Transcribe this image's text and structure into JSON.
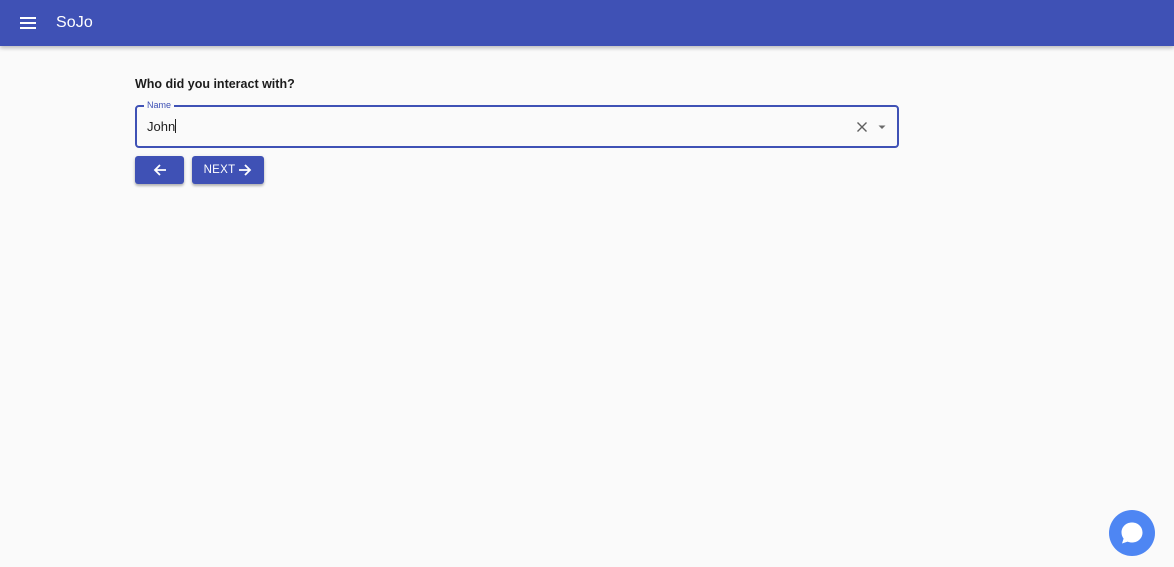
{
  "appbar": {
    "title": "SoJo",
    "menu_icon": "hamburger-menu-icon",
    "color": "#3f51b5"
  },
  "form": {
    "question": "Who did you interact with?",
    "name_field": {
      "label": "Name",
      "value": "John"
    }
  },
  "buttons": {
    "back_icon": "arrow-left-icon",
    "next_label": "NEXT",
    "next_icon": "arrow-right-icon"
  },
  "chat": {
    "icon": "chat-bubble-icon",
    "color": "#4e86f3"
  }
}
